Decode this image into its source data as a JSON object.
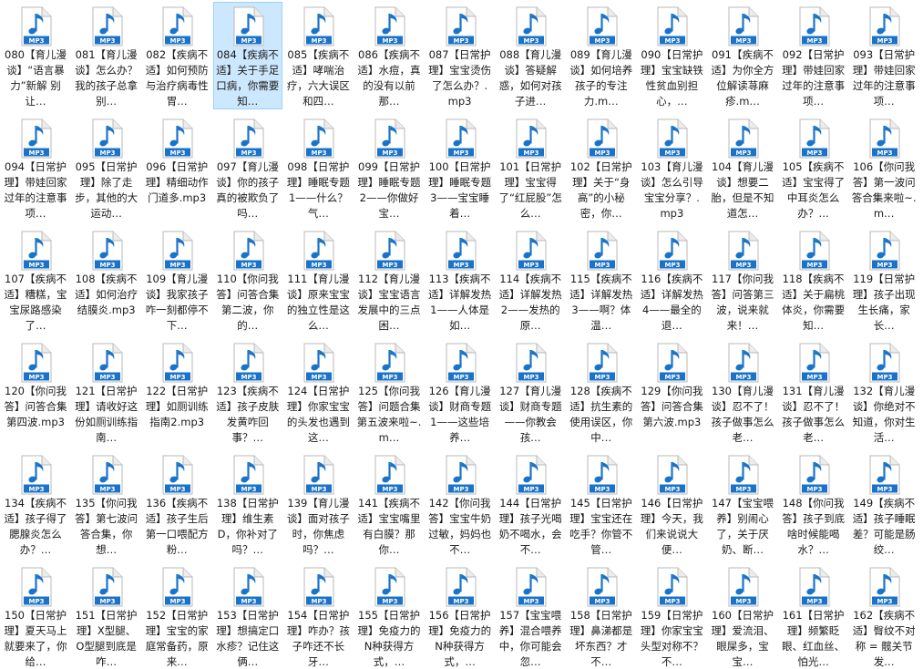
{
  "view": {
    "icon": "mp3-audio-file-icon",
    "icon_badge": "MP3",
    "accent_color": "#1a73c8",
    "selection_color": "#cce8ff"
  },
  "files": [
    {
      "label": "080【育儿漫谈】“语言暴力”新解 别让…"
    },
    {
      "label": "081【育儿漫谈】怎么办？我的孩子总拿别…"
    },
    {
      "label": "082【疾病不适】如何预防与治疗病毒性胃…"
    },
    {
      "label": "084【疾病不适】关于手足口病，你需要知…",
      "selected": true
    },
    {
      "label": "085【疾病不适】哮喘治疗，六大误区和四…"
    },
    {
      "label": "086【疾病不适】水痘，真的没有以前那…"
    },
    {
      "label": "087【日常护理】宝宝烫伤了怎么办？.mp3"
    },
    {
      "label": "088【育儿漫谈】答疑解惑，如何对孩子进…"
    },
    {
      "label": "089【育儿漫谈】如何培养孩子的专注力.m…"
    },
    {
      "label": "090【日常护理】宝宝缺铁性贫血别担心，…"
    },
    {
      "label": "091【疾病不适】为你全方位解读荨麻疹.m…"
    },
    {
      "label": "092【日常护理】带娃回家过年的注意事项…"
    },
    {
      "label": "093【日常护理】带娃回家过年的注意事项…"
    },
    {
      "label": "094【日常护理】带娃回家过年的注意事项…"
    },
    {
      "label": "095【日常护理】除了走步，其他的大运动…"
    },
    {
      "label": "096【日常护理】精细动作门道多.mp3"
    },
    {
      "label": "097【育儿漫谈】你的孩子真的被欺负了吗…"
    },
    {
      "label": "098【日常护理】睡眠专题1——什么？气…"
    },
    {
      "label": "099【日常护理】睡眠专题2——你做好宝…"
    },
    {
      "label": "100【日常护理】睡眠专题3——宝宝睡着…"
    },
    {
      "label": "101【日常护理】宝宝得了“红屁股”怎么…"
    },
    {
      "label": "102【日常护理】关于“身高”的小秘密，你…"
    },
    {
      "label": "103【育儿漫谈】怎么引导宝宝分享？.mp3"
    },
    {
      "label": "104【育儿漫谈】想要二胎，但是不知道怎…"
    },
    {
      "label": "105【疾病不适】宝宝得了中耳炎怎么办？…"
    },
    {
      "label": "106【你问我答】第一波问答合集来啦~.m…"
    },
    {
      "label": "107【疾病不适】糟糕，宝宝尿路感染了…"
    },
    {
      "label": "108【疾病不适】如何治疗结膜炎.mp3"
    },
    {
      "label": "109【育儿漫谈】我家孩子咋一刻都停不下…"
    },
    {
      "label": "110【你问我答】问答合集第二波，你的…"
    },
    {
      "label": "111【育儿漫谈】原来宝宝的独立性是这么…"
    },
    {
      "label": "112【育儿漫谈】宝宝语言发展中的三点困…"
    },
    {
      "label": "113【疾病不适】详解发热1——人体是如…"
    },
    {
      "label": "114【疾病不适】详解发热2——发热的原…"
    },
    {
      "label": "115【疾病不适】详解发热3——啊？体温…"
    },
    {
      "label": "116【疾病不适】详解发热4——最全的退…"
    },
    {
      "label": "117【你问我答】问答第三波，说来就来！…"
    },
    {
      "label": "118【疾病不适】关于扁桃体炎，你需要知…"
    },
    {
      "label": "119【日常护理】孩子出现生长痛，家长…"
    },
    {
      "label": "120【你问我答】问答合集第四波.mp3"
    },
    {
      "label": "121【日常护理】请收好这份如厕训练指南…"
    },
    {
      "label": "122【日常护理】如厕训练指南2.mp3"
    },
    {
      "label": "123【疾病不适】孩子皮肤发黄咋回事？…"
    },
    {
      "label": "124【日常护理】你家宝宝的头发也遇到这…"
    },
    {
      "label": "125【你问我答】问题合集第五波来啦~.m…"
    },
    {
      "label": "126【育儿漫谈】财商专题1——这些培养…"
    },
    {
      "label": "127【育儿漫谈】财商专题——你教会孩…"
    },
    {
      "label": "128【疾病不适】抗生素的使用误区，你中…"
    },
    {
      "label": "129【你问我答】问答合集第六波.mp3"
    },
    {
      "label": "130【育儿漫谈】忍不了！孩子做事怎么老…"
    },
    {
      "label": "131【育儿漫谈】忍不了！孩子做事怎么老…"
    },
    {
      "label": "132【育儿漫谈】你绝对不知道，你对生活…"
    },
    {
      "label": "134【疾病不适】孩子得了腮腺炎怎么办？…"
    },
    {
      "label": "135【你问我答】第七波问答合集，你想…"
    },
    {
      "label": "136【疾病不适】孩子生后第一口喂配方粉…"
    },
    {
      "label": "138【日常护理】维生素D，你补对了吗？…"
    },
    {
      "label": "139【育儿漫谈】面对孩子时，你焦虑吗？…"
    },
    {
      "label": "141【疾病不适】宝宝嘴里有白膜？那你…"
    },
    {
      "label": "142【你问我答】宝宝牛奶过敏，妈妈也不…"
    },
    {
      "label": "144【日常护理】孩子光喝奶不喝水，会不…"
    },
    {
      "label": "145【日常护理】宝宝还在吃手？你管不管…"
    },
    {
      "label": "146【日常护理】今天，我们来说说大便…"
    },
    {
      "label": "147【宝宝喂养】别闹心了，关于厌奶、断…"
    },
    {
      "label": "148【你问我答】孩子到底啥时候能喝水？…"
    },
    {
      "label": "149【疾病不适】孩子睡眠差？可能是肠绞…"
    },
    {
      "label": "150【日常护理】夏天马上就要来了，你给…"
    },
    {
      "label": "151【日常护理】X型腿、O型腿到底是咋…"
    },
    {
      "label": "152【日常护理】宝宝的家庭常备药，原来…"
    },
    {
      "label": "153【日常护理】想搞定口水疹？记住这俩…"
    },
    {
      "label": "154【日常护理】咋办？孩子咋还不长牙…"
    },
    {
      "label": "155【日常护理】免疫力的N种获得方式，…"
    },
    {
      "label": "156【日常护理】免疫力的N种获得方式，…"
    },
    {
      "label": "157【宝宝喂养】混合喂养中，你可能会忽…"
    },
    {
      "label": "158【日常护理】鼻涕都是坏东西？才不…"
    },
    {
      "label": "159【日常护理】你家宝宝头型对称不？不…"
    },
    {
      "label": "160【日常护理】爱流泪、眼屎多，宝宝…"
    },
    {
      "label": "161【日常护理】频繁眨眼、红血丝、怕光…"
    },
    {
      "label": "162【疾病不适】臀纹不对称 = 髋关节发…"
    }
  ]
}
